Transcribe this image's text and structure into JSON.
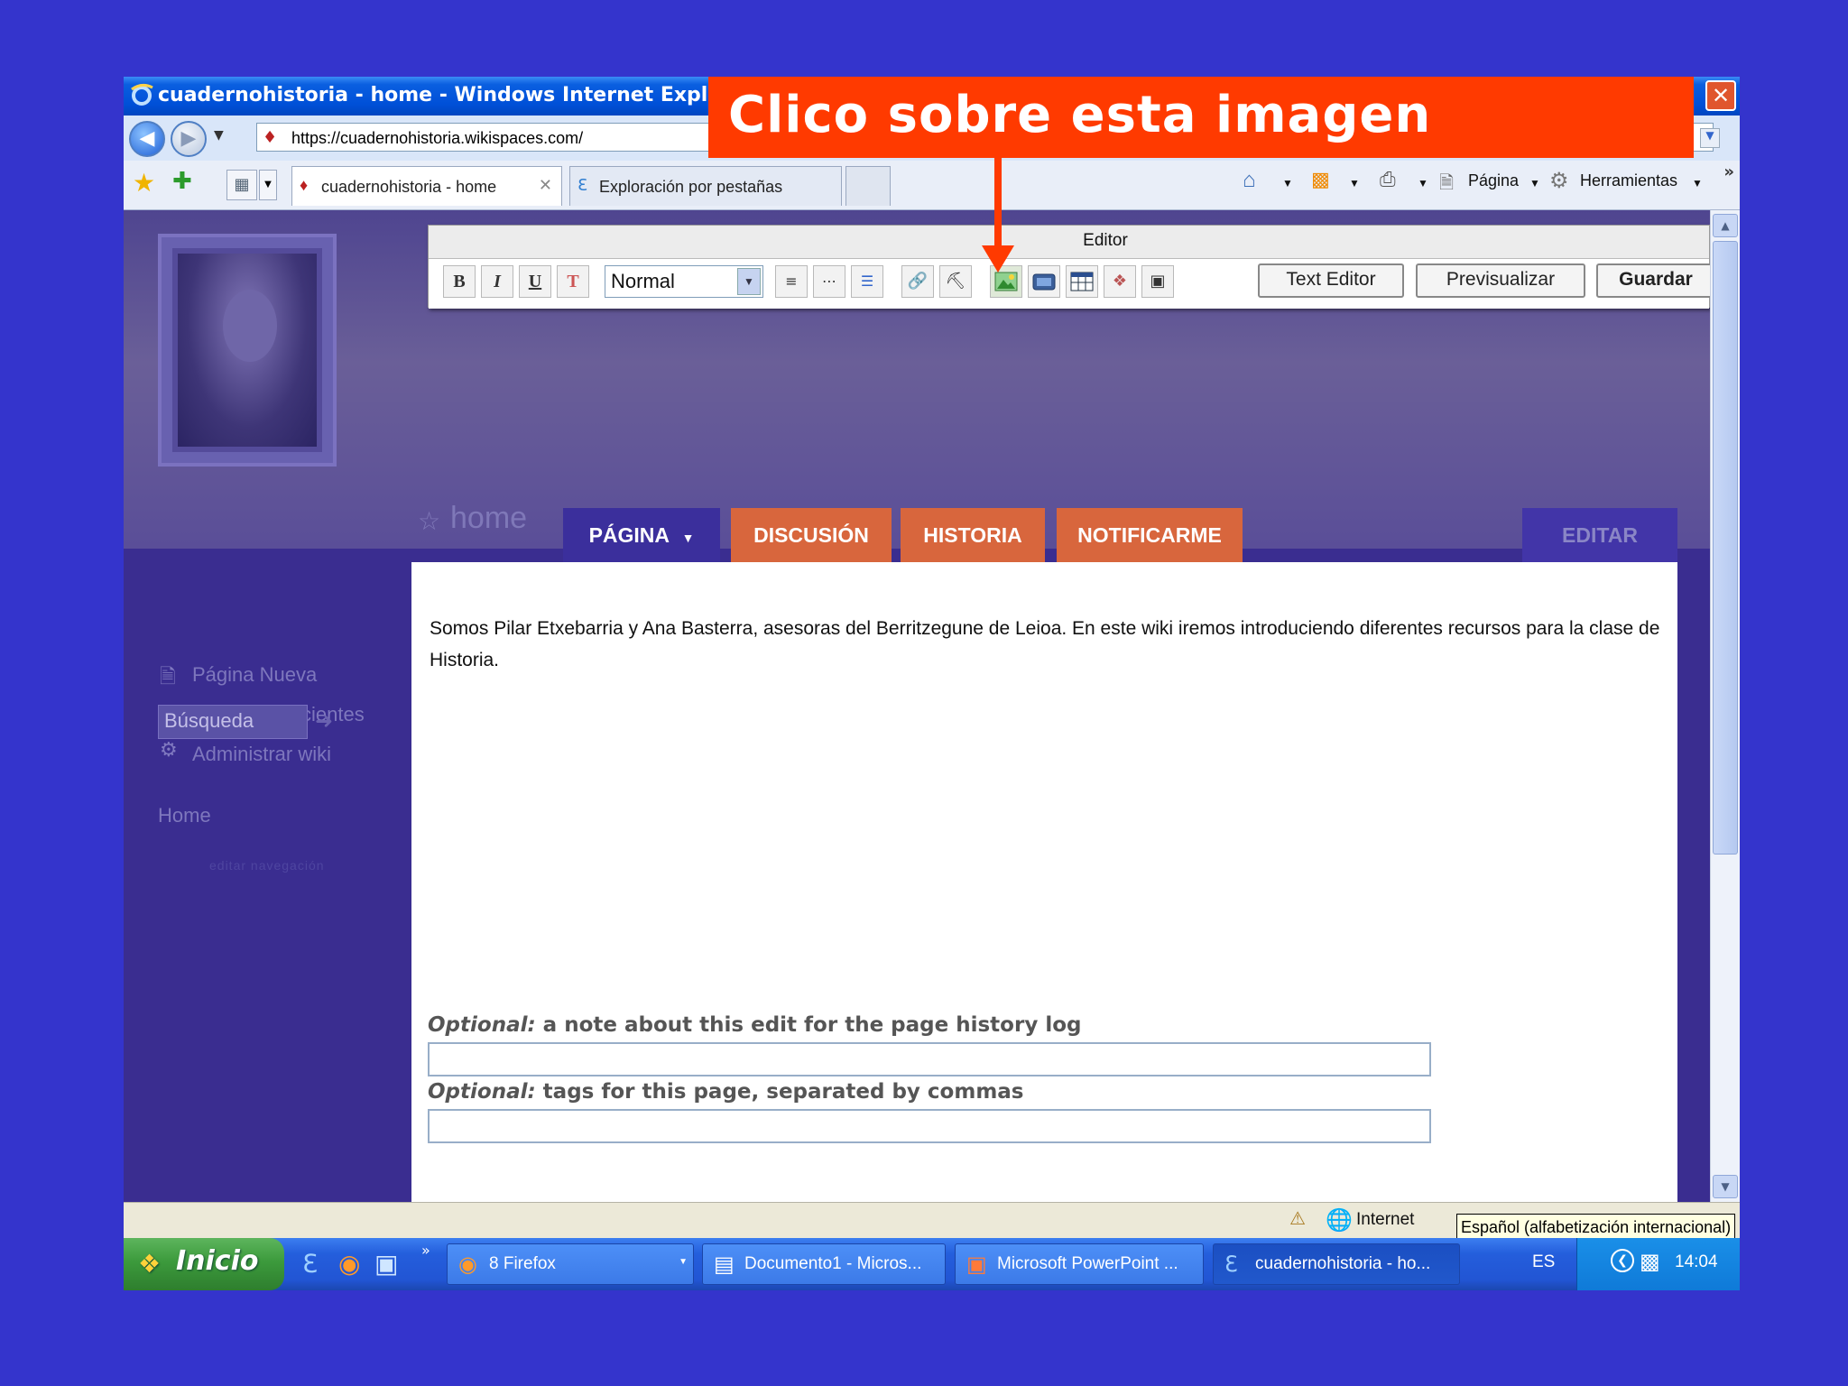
{
  "window": {
    "title": "cuadernohistoria - home - Windows Internet Explorer",
    "close_glyph": "✕"
  },
  "address_bar": {
    "url": "https://cuadernohistoria.wikispaces.com/"
  },
  "tabs": [
    {
      "label": "cuadernohistoria - home"
    },
    {
      "label": "Exploración por pestañas"
    }
  ],
  "command_bar": {
    "page_label": "Página",
    "tools_label": "Herramientas",
    "more": "»"
  },
  "editor": {
    "title": "Editor",
    "format_value": "Normal",
    "buttons": {
      "bold": "B",
      "italic": "I",
      "underline": "U",
      "text_editor": "Text Editor",
      "preview": "Previsualizar",
      "save": "Guardar"
    }
  },
  "wiki": {
    "home_label": "home",
    "page_tabs": {
      "pagina": "PÁGINA",
      "discusion": "DISCUSIÓN",
      "historia": "HISTORIA",
      "notificarme": "NOTIFICARME",
      "editar": "EDITAR"
    },
    "sidebar": {
      "new_page": "Página Nueva",
      "recent_changes": "Cambios Recientes",
      "manage_wiki": "Administrar wiki",
      "search_placeholder": "Búsqueda",
      "home": "Home",
      "edit_nav": "editar navegación"
    },
    "content_text": "Somos Pilar Etxebarria y Ana Basterra, asesoras del Berritzegune de Leioa. En este wiki iremos introduciendo diferentes recursos para la clase de Historia.",
    "optional_1": {
      "prefix": "Optional:",
      "text": " a note about this edit for the page history log"
    },
    "optional_2": {
      "prefix": "Optional:",
      "text": " tags for this page, separated by commas"
    }
  },
  "status_bar": {
    "zone": "Internet",
    "language_tooltip": "Español (alfabetización internacional)"
  },
  "taskbar": {
    "start": "Inicio",
    "tasks": [
      {
        "label": "8 Firefox"
      },
      {
        "label": "Documento1 - Micros..."
      },
      {
        "label": "Microsoft PowerPoint ..."
      },
      {
        "label": "cuadernohistoria - ho..."
      }
    ],
    "lang": "ES",
    "clock": "14:04"
  },
  "annotation": {
    "text": "Clico sobre esta imagen"
  },
  "colors": {
    "slide_background": "#3434cc",
    "callout": "#ff3a00",
    "tab_active": "#3b2f9c",
    "tab_orange": "#d8663d"
  }
}
